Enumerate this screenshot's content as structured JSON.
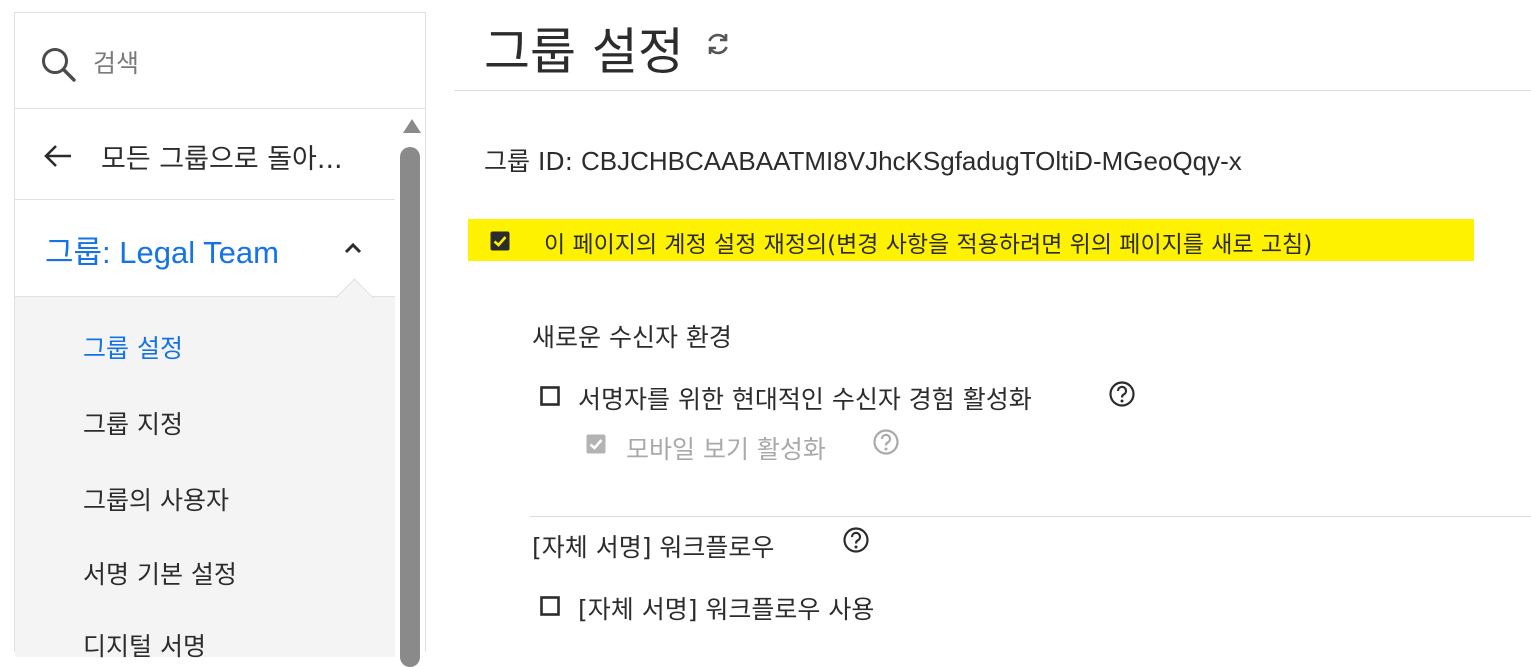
{
  "sidebar": {
    "search_placeholder": "검색",
    "back_label": "모든 그룹으로 돌아...",
    "group_label": "그룹: Legal Team",
    "items": [
      {
        "label": "그룹 설정"
      },
      {
        "label": "그룹 지정"
      },
      {
        "label": "그룹의 사용자"
      },
      {
        "label": "서명 기본 설정"
      },
      {
        "label": "디지털 서명"
      }
    ]
  },
  "main": {
    "title": "그룹 설정",
    "group_id_label": "그룹 ID:",
    "group_id_value": "CBJCHBCAABAATMI8VJhcKSgfadugTOltiD-MGeoQqy-x",
    "override_label": "이 페이지의 계정 설정 재정의(변경 사항을 적용하려면 위의 페이지를 새로 고침)",
    "recipient_section": {
      "title": "새로운 수신자 환경",
      "modern_experience_label": "서명자를 위한 현대적인 수신자 경험 활성화",
      "mobile_view_label": "모바일 보기 활성화"
    },
    "self_sign_section": {
      "title": "[자체 서명] 워크플로우",
      "use_label": "[자체 서명] 워크플로우 사용"
    }
  },
  "colors": {
    "accent": "#1473e6",
    "highlight": "#fff200"
  }
}
